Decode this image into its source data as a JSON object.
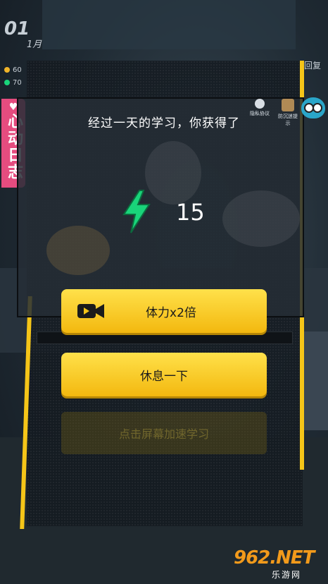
{
  "hud": {
    "date_day": "01",
    "date_month": "1月",
    "stat_a": "60",
    "stat_b": "70",
    "diary_tab": "心动日志",
    "top_right_text": "回复",
    "privacy_label": "隐私协议",
    "anti_addiction_label": "防沉迷提示"
  },
  "reward": {
    "title": "经过一天的学习，你获得了",
    "value": "15",
    "icon": "lightning-bolt-icon",
    "icon_color": "#19d47a"
  },
  "buttons": {
    "double_label": "体力x2倍",
    "rest_label": "休息一下",
    "hint_label": "点击屏幕加速学习"
  },
  "watermark": {
    "main": "962.NET",
    "sub": "乐游网"
  },
  "colors": {
    "accent_yellow": "#f5c518",
    "diary_pink": "#e54c7f"
  }
}
